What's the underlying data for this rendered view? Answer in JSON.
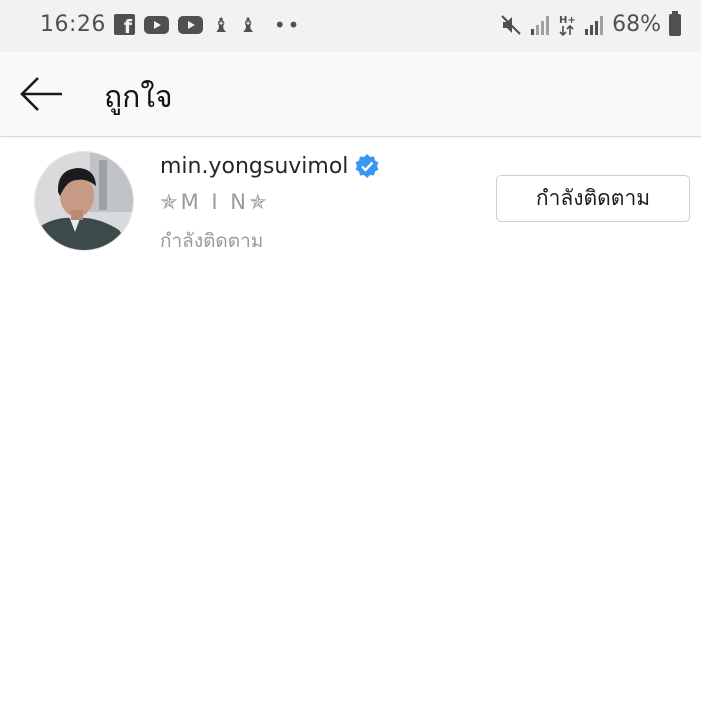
{
  "status_bar": {
    "time": "16:26",
    "battery_percent": "68%",
    "left_icons": [
      "facebook-icon",
      "youtube-icon",
      "youtube-icon",
      "notification-icon",
      "notification-icon",
      "more-dots-icon"
    ],
    "right_icons": [
      "mute-icon",
      "signal-icon",
      "data-hplus-icon",
      "signal-icon",
      "battery-icon"
    ]
  },
  "app_bar": {
    "back_icon": "arrow-left-icon",
    "title": "ถูกใจ"
  },
  "user": {
    "username": "min.yongsuvimol",
    "verified": true,
    "full_name": "✯M I N✯",
    "status_text": "กำลังติดตาม",
    "follow_button_label": "กำลังติดตาม"
  },
  "colors": {
    "verified_blue": "#3897f0",
    "status_bar_bg": "#f3f1f4",
    "app_bar_bg": "#fbf8fb",
    "secondary_text": "#9a9a9a"
  }
}
